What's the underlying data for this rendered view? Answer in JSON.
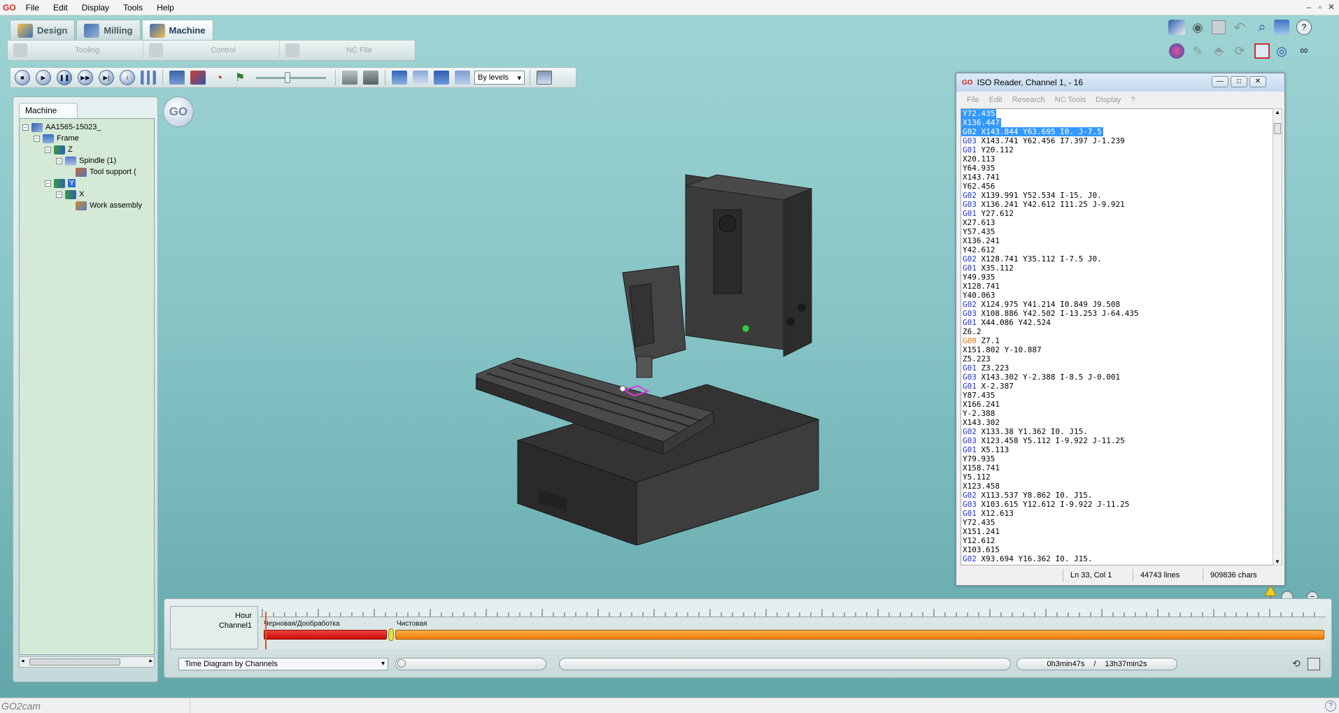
{
  "app": {
    "logo_prefix": "GO",
    "logo_suffix": "",
    "status_name": "GO2cam"
  },
  "menubar": [
    "File",
    "Edit",
    "Display",
    "Tools",
    "Help"
  ],
  "window_controls": [
    "–",
    "▫",
    "✕"
  ],
  "mode_tabs": {
    "design": "Design",
    "milling": "Milling",
    "machine": "Machine"
  },
  "sub_toolbar": {
    "tooling": "Tooling",
    "control": "Control",
    "nc_file": "NC File"
  },
  "toolbar": {
    "levels_select": "By levels",
    "slider_value": 0.45
  },
  "left_panel": {
    "tab": "Machine",
    "tree": [
      {
        "label": "AA1565-15023_",
        "depth": 0
      },
      {
        "label": "Frame",
        "depth": 1
      },
      {
        "label": "Z",
        "depth": 2
      },
      {
        "label": "Spindle (1)",
        "depth": 3
      },
      {
        "label": "Tool support (",
        "depth": 4
      },
      {
        "label": "Y",
        "depth": 2,
        "selected": true
      },
      {
        "label": "X",
        "depth": 3
      },
      {
        "label": "Work assembly",
        "depth": 4
      }
    ]
  },
  "go_badge": "GO",
  "iso_reader": {
    "title": "ISO Reader, Channel 1, - 16",
    "menu": [
      "File",
      "Edit",
      "Research",
      "NC Tools",
      "Display",
      "?"
    ],
    "lines": [
      {
        "code": "",
        "rest": "Y72.435",
        "sel": true
      },
      {
        "code": "",
        "rest": "X136.447",
        "sel": true
      },
      {
        "code": "G02",
        "rest": " X143.844 Y63.695 I0. J-7.5",
        "sel": true
      },
      {
        "code": "G03",
        "rest": " X143.741 Y62.456 I7.397 J-1.239"
      },
      {
        "code": "G01",
        "rest": " Y20.112"
      },
      {
        "code": "",
        "rest": "X20.113"
      },
      {
        "code": "",
        "rest": "Y64.935"
      },
      {
        "code": "",
        "rest": "X143.741"
      },
      {
        "code": "",
        "rest": "Y62.456"
      },
      {
        "code": "G02",
        "rest": " X139.991 Y52.534 I-15. J0."
      },
      {
        "code": "G03",
        "rest": " X136.241 Y42.612 I11.25 J-9.921"
      },
      {
        "code": "G01",
        "rest": " Y27.612"
      },
      {
        "code": "",
        "rest": "X27.613"
      },
      {
        "code": "",
        "rest": "Y57.435"
      },
      {
        "code": "",
        "rest": "X136.241"
      },
      {
        "code": "",
        "rest": "Y42.612"
      },
      {
        "code": "G02",
        "rest": " X128.741 Y35.112 I-7.5 J0."
      },
      {
        "code": "G01",
        "rest": " X35.112"
      },
      {
        "code": "",
        "rest": "Y49.935"
      },
      {
        "code": "",
        "rest": "X128.741"
      },
      {
        "code": "",
        "rest": "Y40.063"
      },
      {
        "code": "G02",
        "rest": " X124.975 Y41.214 I0.849 J9.508"
      },
      {
        "code": "G03",
        "rest": " X108.886 Y42.502 I-13.253 J-64.435"
      },
      {
        "code": "G01",
        "rest": " X44.086 Y42.524"
      },
      {
        "code": "",
        "rest": "Z6.2"
      },
      {
        "code": "G00",
        "rest": " Z7.1",
        "rapid": true
      },
      {
        "code": "",
        "rest": "X151.802 Y-10.887"
      },
      {
        "code": "",
        "rest": "Z5.223"
      },
      {
        "code": "G01",
        "rest": " Z3.223"
      },
      {
        "code": "G03",
        "rest": " X143.302 Y-2.388 I-8.5 J-0.001"
      },
      {
        "code": "G01",
        "rest": " X-2.387"
      },
      {
        "code": "",
        "rest": "Y87.435"
      },
      {
        "code": "",
        "rest": "X166.241"
      },
      {
        "code": "",
        "rest": "Y-2.388"
      },
      {
        "code": "",
        "rest": "X143.302"
      },
      {
        "code": "G02",
        "rest": " X133.38 Y1.362 I0. J15."
      },
      {
        "code": "G03",
        "rest": " X123.458 Y5.112 I-9.922 J-11.25"
      },
      {
        "code": "G01",
        "rest": " X5.113"
      },
      {
        "code": "",
        "rest": "Y79.935"
      },
      {
        "code": "",
        "rest": "X158.741"
      },
      {
        "code": "",
        "rest": "Y5.112"
      },
      {
        "code": "",
        "rest": "X123.458"
      },
      {
        "code": "G02",
        "rest": " X113.537 Y8.862 I0. J15."
      },
      {
        "code": "G03",
        "rest": " X103.615 Y12.612 I-9.922 J-11.25"
      },
      {
        "code": "G01",
        "rest": " X12.613"
      },
      {
        "code": "",
        "rest": "Y72.435"
      },
      {
        "code": "",
        "rest": "X151.241"
      },
      {
        "code": "",
        "rest": "Y12.612"
      },
      {
        "code": "",
        "rest": "X103.615"
      },
      {
        "code": "G02",
        "rest": " X93.694 Y16.362 I0. J15."
      }
    ],
    "status": {
      "position": "Ln 33, Col 1",
      "lines": "44743 lines",
      "chars": "909836 chars"
    }
  },
  "timeline": {
    "hour_label": "Hour",
    "channel_label": "Channel1",
    "phase_rough": "Черновая/Дообработка",
    "phase_finish": "Чистовая",
    "rough_fraction": 0.12,
    "view_select": "Time Diagram by Channels",
    "elapsed": "0h3min47s",
    "separator": "/",
    "total": "13h37min2s"
  },
  "colors": {
    "background_top": "#9fd4d4",
    "background_bottom": "#62a6a9",
    "gcode_blue": "#1c2fd8",
    "gcode_rapid": "#e0700e",
    "selection": "#3399ff",
    "phase_rough": "#d8201c",
    "phase_finish": "#f08c1e",
    "machine_body": "#3a3a3a"
  },
  "icons": [
    "design-icon",
    "milling-icon",
    "machine-icon",
    "stop-icon",
    "play-icon",
    "pause-icon",
    "fast-forward-icon",
    "step-end-icon",
    "info-icon",
    "camera-icon",
    "zoom-icon",
    "refresh-icon",
    "help-icon",
    "eye-icon"
  ]
}
